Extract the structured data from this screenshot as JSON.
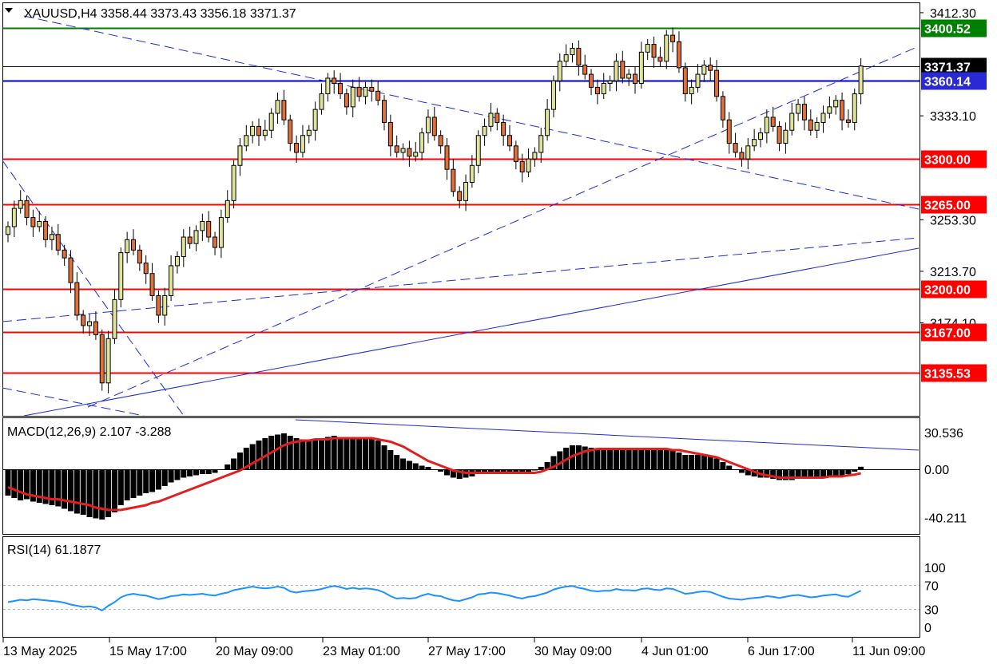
{
  "header": {
    "symbol_line": "XAUUSD,H4  3358.44 3373.43 3356.18 3371.37",
    "macd_title": "MACD(12,26,9) 2.107 -3.288",
    "rsi_title": "RSI(14) 61.1877"
  },
  "colors": {
    "bull_candle": "#dfe49a",
    "bear_candle": "#e0703a",
    "support_line": "#ff0000",
    "resistance_line": "#008000",
    "trend_line": "#1f2bd8",
    "price_line": "#0000b8",
    "macd_signal": "#e31e1e",
    "rsi_line": "#1e90ff"
  },
  "chart_data": [
    {
      "type": "candlestick",
      "name": "price",
      "y_ticks": [
        "3412.30",
        "3333.10",
        "3253.30",
        "3213.70",
        "3174.10"
      ],
      "ylim": [
        3100,
        3420
      ],
      "x_tick_labels": [
        "13 May 2025",
        "15 May 17:00",
        "20 May 09:00",
        "23 May 01:00",
        "27 May 17:00",
        "30 May 09:00",
        "4 Jun 01:00",
        "6 Jun 17:00",
        "11 Jun 09:00"
      ],
      "levels": [
        {
          "value": 3400.52,
          "label": "3400.52",
          "kind": "resistance"
        },
        {
          "value": 3371.37,
          "label": "3371.37",
          "kind": "current"
        },
        {
          "value": 3360.14,
          "label": "3360.14",
          "kind": "pivot"
        },
        {
          "value": 3300.0,
          "label": "3300.00",
          "kind": "support"
        },
        {
          "value": 3265.0,
          "label": "3265.00",
          "kind": "support"
        },
        {
          "value": 3200.0,
          "label": "3200.00",
          "kind": "support"
        },
        {
          "value": 3167.0,
          "label": "3167.00",
          "kind": "support"
        },
        {
          "value": 3135.53,
          "label": "3135.53",
          "kind": "support"
        }
      ],
      "close": [
        3248,
        3262,
        3268,
        3255,
        3248,
        3252,
        3238,
        3242,
        3230,
        3224,
        3205,
        3180,
        3172,
        3175,
        3165,
        3128,
        3162,
        3192,
        3228,
        3238,
        3230,
        3220,
        3212,
        3195,
        3180,
        3195,
        3218,
        3225,
        3240,
        3235,
        3245,
        3252,
        3240,
        3232,
        3255,
        3268,
        3295,
        3310,
        3318,
        3325,
        3318,
        3322,
        3335,
        3345,
        3330,
        3312,
        3305,
        3318,
        3322,
        3338,
        3350,
        3362,
        3358,
        3350,
        3340,
        3355,
        3348,
        3355,
        3352,
        3345,
        3328,
        3310,
        3305,
        3308,
        3302,
        3305,
        3320,
        3332,
        3318,
        3310,
        3292,
        3275,
        3268,
        3282,
        3295,
        3318,
        3325,
        3335,
        3328,
        3318,
        3310,
        3298,
        3290,
        3300,
        3305,
        3318,
        3338,
        3360,
        3375,
        3380,
        3385,
        3372,
        3365,
        3355,
        3350,
        3358,
        3360,
        3375,
        3362,
        3365,
        3358,
        3382,
        3388,
        3378,
        3375,
        3395,
        3390,
        3370,
        3350,
        3355,
        3365,
        3372,
        3368,
        3348,
        3330,
        3312,
        3305,
        3300,
        3310,
        3315,
        3320,
        3332,
        3325,
        3312,
        3322,
        3335,
        3342,
        3330,
        3322,
        3328,
        3335,
        3340,
        3345,
        3330,
        3328,
        3350,
        3371.37
      ],
      "macd_hist": [
        -22,
        -24,
        -26,
        -25,
        -27,
        -28,
        -29,
        -30,
        -31,
        -33,
        -35,
        -37,
        -38,
        -40,
        -41,
        -42,
        -40,
        -36,
        -30,
        -26,
        -24,
        -22,
        -20,
        -19,
        -17,
        -14,
        -11,
        -9,
        -7,
        -6,
        -5,
        -4,
        -4,
        -3,
        0,
        4,
        9,
        14,
        18,
        21,
        24,
        26,
        28,
        29,
        30,
        28,
        26,
        25,
        24,
        25,
        26,
        27,
        28,
        27,
        26,
        26,
        27,
        26,
        25,
        24,
        20,
        16,
        12,
        9,
        7,
        5,
        3,
        2,
        0,
        -2,
        -5,
        -7,
        -8,
        -7,
        -6,
        -4,
        -3,
        -2,
        -2,
        -2,
        -3,
        -3,
        -3,
        -2,
        -1,
        2,
        6,
        11,
        15,
        18,
        20,
        20,
        19,
        18,
        17,
        17,
        17,
        18,
        17,
        17,
        16,
        17,
        17,
        16,
        16,
        17,
        16,
        14,
        12,
        12,
        12,
        12,
        11,
        9,
        6,
        3,
        0,
        -3,
        -5,
        -6,
        -7,
        -7,
        -8,
        -9,
        -9,
        -9,
        -8,
        -8,
        -7,
        -7,
        -6,
        -6,
        -5,
        -5,
        -4,
        -2,
        2.107
      ],
      "macd_signal": [
        -15,
        -17,
        -19,
        -21,
        -22,
        -23,
        -24,
        -25,
        -25,
        -26,
        -27,
        -28,
        -29,
        -30,
        -32,
        -33,
        -34,
        -34,
        -34,
        -33,
        -32,
        -31,
        -30,
        -28,
        -27,
        -25,
        -23,
        -21,
        -19,
        -17,
        -15,
        -13,
        -11,
        -9,
        -7,
        -5,
        -3,
        -1,
        2,
        5,
        8,
        11,
        14,
        17,
        20,
        22,
        23,
        24,
        24,
        25,
        25,
        25,
        26,
        26,
        26,
        26,
        26,
        26,
        26,
        25,
        24,
        23,
        21,
        19,
        16,
        13,
        10,
        7,
        5,
        3,
        1,
        -1,
        -2,
        -3,
        -3,
        -3,
        -3,
        -3,
        -3,
        -3,
        -3,
        -3,
        -3,
        -3,
        -3,
        -2,
        0,
        2,
        5,
        8,
        11,
        13,
        15,
        16,
        17,
        17,
        17,
        17,
        17,
        17,
        17,
        17,
        17,
        17,
        17,
        17,
        16,
        16,
        15,
        14,
        13,
        12,
        11,
        10,
        8,
        6,
        4,
        2,
        0,
        -2,
        -4,
        -5,
        -6,
        -7,
        -7,
        -7,
        -7,
        -7,
        -7,
        -7,
        -7,
        -6,
        -6,
        -6,
        -5,
        -4.5,
        -3.288
      ],
      "rsi": [
        42,
        44,
        46,
        45,
        47,
        46,
        45,
        44,
        43,
        41,
        38,
        36,
        34,
        35,
        33,
        28,
        36,
        42,
        50,
        54,
        56,
        54,
        53,
        50,
        47,
        49,
        52,
        53,
        55,
        54,
        55,
        56,
        54,
        53,
        56,
        58,
        62,
        64,
        66,
        68,
        66,
        65,
        66,
        68,
        66,
        60,
        58,
        60,
        61,
        62,
        64,
        67,
        69,
        67,
        64,
        66,
        64,
        65,
        64,
        62,
        58,
        52,
        48,
        49,
        48,
        49,
        53,
        56,
        53,
        52,
        48,
        45,
        44,
        47,
        50,
        55,
        56,
        58,
        57,
        55,
        53,
        50,
        48,
        51,
        52,
        55,
        58,
        63,
        66,
        68,
        69,
        66,
        64,
        61,
        60,
        61,
        61,
        64,
        62,
        62,
        61,
        64,
        65,
        63,
        62,
        65,
        64,
        60,
        56,
        57,
        59,
        60,
        59,
        55,
        51,
        48,
        47,
        46,
        48,
        49,
        50,
        52,
        51,
        49,
        51,
        53,
        54,
        52,
        50,
        51,
        53,
        54,
        55,
        52,
        51,
        56,
        61.1877
      ],
      "macd_ticks": [
        "30.536",
        "0.00",
        "-40.211"
      ],
      "rsi_ticks": [
        "100",
        "70",
        "30",
        "0"
      ]
    }
  ]
}
